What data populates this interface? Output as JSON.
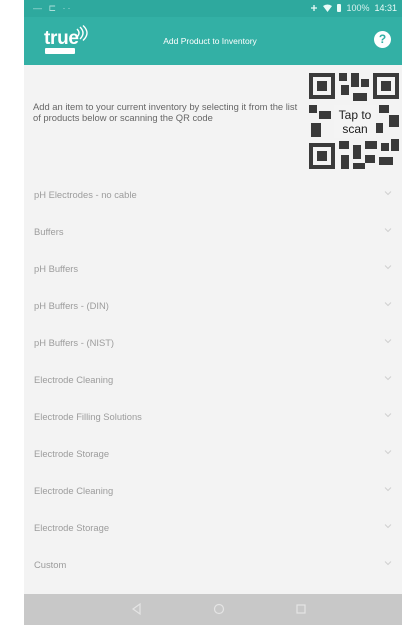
{
  "status_bar": {
    "left_icons": "— ⊏ ··",
    "battery": "100%",
    "time": "14:31"
  },
  "app_bar": {
    "logo_text": "true",
    "logo_subtext": "SENSE",
    "title": "Add Product to Inventory",
    "help_label": "?"
  },
  "intro": {
    "text": "Add an item to your current inventory by selecting it from the list of products below or scanning the QR code",
    "qr_label": "Tap to scan"
  },
  "products": [
    {
      "label": "pH Electrodes - no cable"
    },
    {
      "label": "Buffers"
    },
    {
      "label": "pH Buffers"
    },
    {
      "label": "pH Buffers - (DIN)"
    },
    {
      "label": "pH Buffers - (NIST)"
    },
    {
      "label": "Electrode Cleaning"
    },
    {
      "label": "Electrode Filling Solutions"
    },
    {
      "label": "Electrode Storage"
    },
    {
      "label": "Electrode Cleaning"
    },
    {
      "label": "Electrode Storage"
    },
    {
      "label": "Custom"
    }
  ],
  "icons": {
    "wifi": "wifi-icon",
    "signal": "signal-icon",
    "battery": "battery-icon",
    "help": "help-icon",
    "qr": "qr-code-icon",
    "chevron": "chevron-down-icon",
    "back": "back-icon",
    "home": "home-icon",
    "recent": "recent-apps-icon"
  },
  "colors": {
    "status_bar": "#2ea99e",
    "app_bar": "#33b0a5",
    "background": "#f3f3f3",
    "nav_bar": "#c8c8c8"
  }
}
